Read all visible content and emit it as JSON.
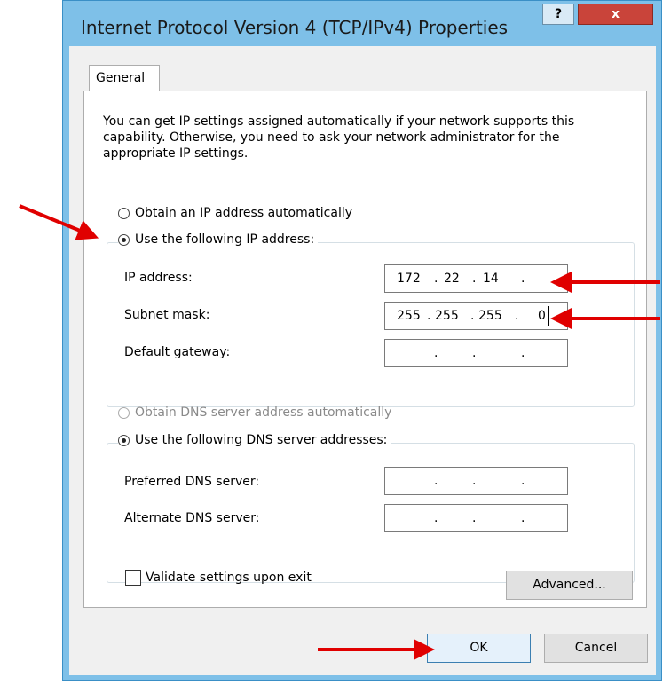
{
  "window": {
    "title": "Internet Protocol Version 4 (TCP/IPv4) Properties",
    "help_label": "?",
    "close_label": "x"
  },
  "tab": {
    "label": "General"
  },
  "description": "You can get IP settings assigned automatically if your network supports this capability. Otherwise, you need to ask your network administrator for the appropriate IP settings.",
  "ip": {
    "auto_label": "Obtain an IP address automatically",
    "manual_label": "Use the following IP address:",
    "selected": "manual",
    "address_label": "IP address:",
    "address_octets": [
      "172",
      "22",
      "14",
      ""
    ],
    "subnet_label": "Subnet mask:",
    "subnet_octets": [
      "255",
      "255",
      "255",
      "0"
    ],
    "gateway_label": "Default gateway:",
    "gateway_octets": [
      "",
      "",
      "",
      ""
    ]
  },
  "dns": {
    "auto_label": "Obtain DNS server address automatically",
    "manual_label": "Use the following DNS server addresses:",
    "selected": "manual",
    "preferred_label": "Preferred DNS server:",
    "preferred_octets": [
      "",
      "",
      "",
      ""
    ],
    "alternate_label": "Alternate DNS server:",
    "alternate_octets": [
      "",
      "",
      "",
      ""
    ]
  },
  "validate": {
    "label": "Validate settings upon exit",
    "checked": false
  },
  "buttons": {
    "advanced": "Advanced...",
    "ok": "OK",
    "cancel": "Cancel"
  },
  "annotation_color": "#e00000"
}
